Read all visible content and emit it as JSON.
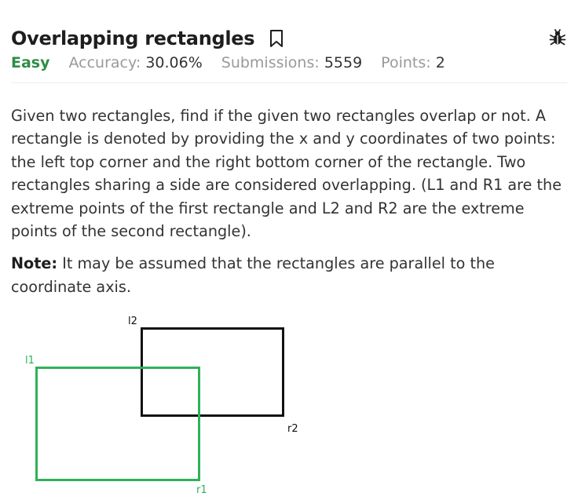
{
  "problem": {
    "title": "Overlapping rectangles",
    "difficulty": "Easy",
    "accuracy_label": "Accuracy:",
    "accuracy_value": "30.06%",
    "submissions_label": "Submissions:",
    "submissions_value": "5559",
    "points_label": "Points:",
    "points_value": "2"
  },
  "description": {
    "paragraph": "Given two rectangles, find if the given two rectangles overlap or not. A rectangle is denoted by providing the x and y coordinates of two points: the left top corner and the right bottom corner of the rectangle. Two rectangles sharing a side are considered overlapping. (L1 and R1 are the extreme points of the first rectangle and L2 and R2 are the extreme points of the second rectangle).",
    "note_label": "Note:",
    "note_text": " It may be assumed that the rectangles are parallel to the coordinate axis."
  },
  "figure": {
    "label_l1": "l1",
    "label_r1": "r1",
    "label_l2": "l2",
    "label_r2": "r2",
    "rect1_color": "#2fb15a",
    "rect2_color": "#111111"
  },
  "icons": {
    "bookmark": "bookmark-icon",
    "bug": "bug-icon"
  },
  "colors": {
    "accent_green": "#2f8d46",
    "muted_gray": "#9a9a9a"
  }
}
